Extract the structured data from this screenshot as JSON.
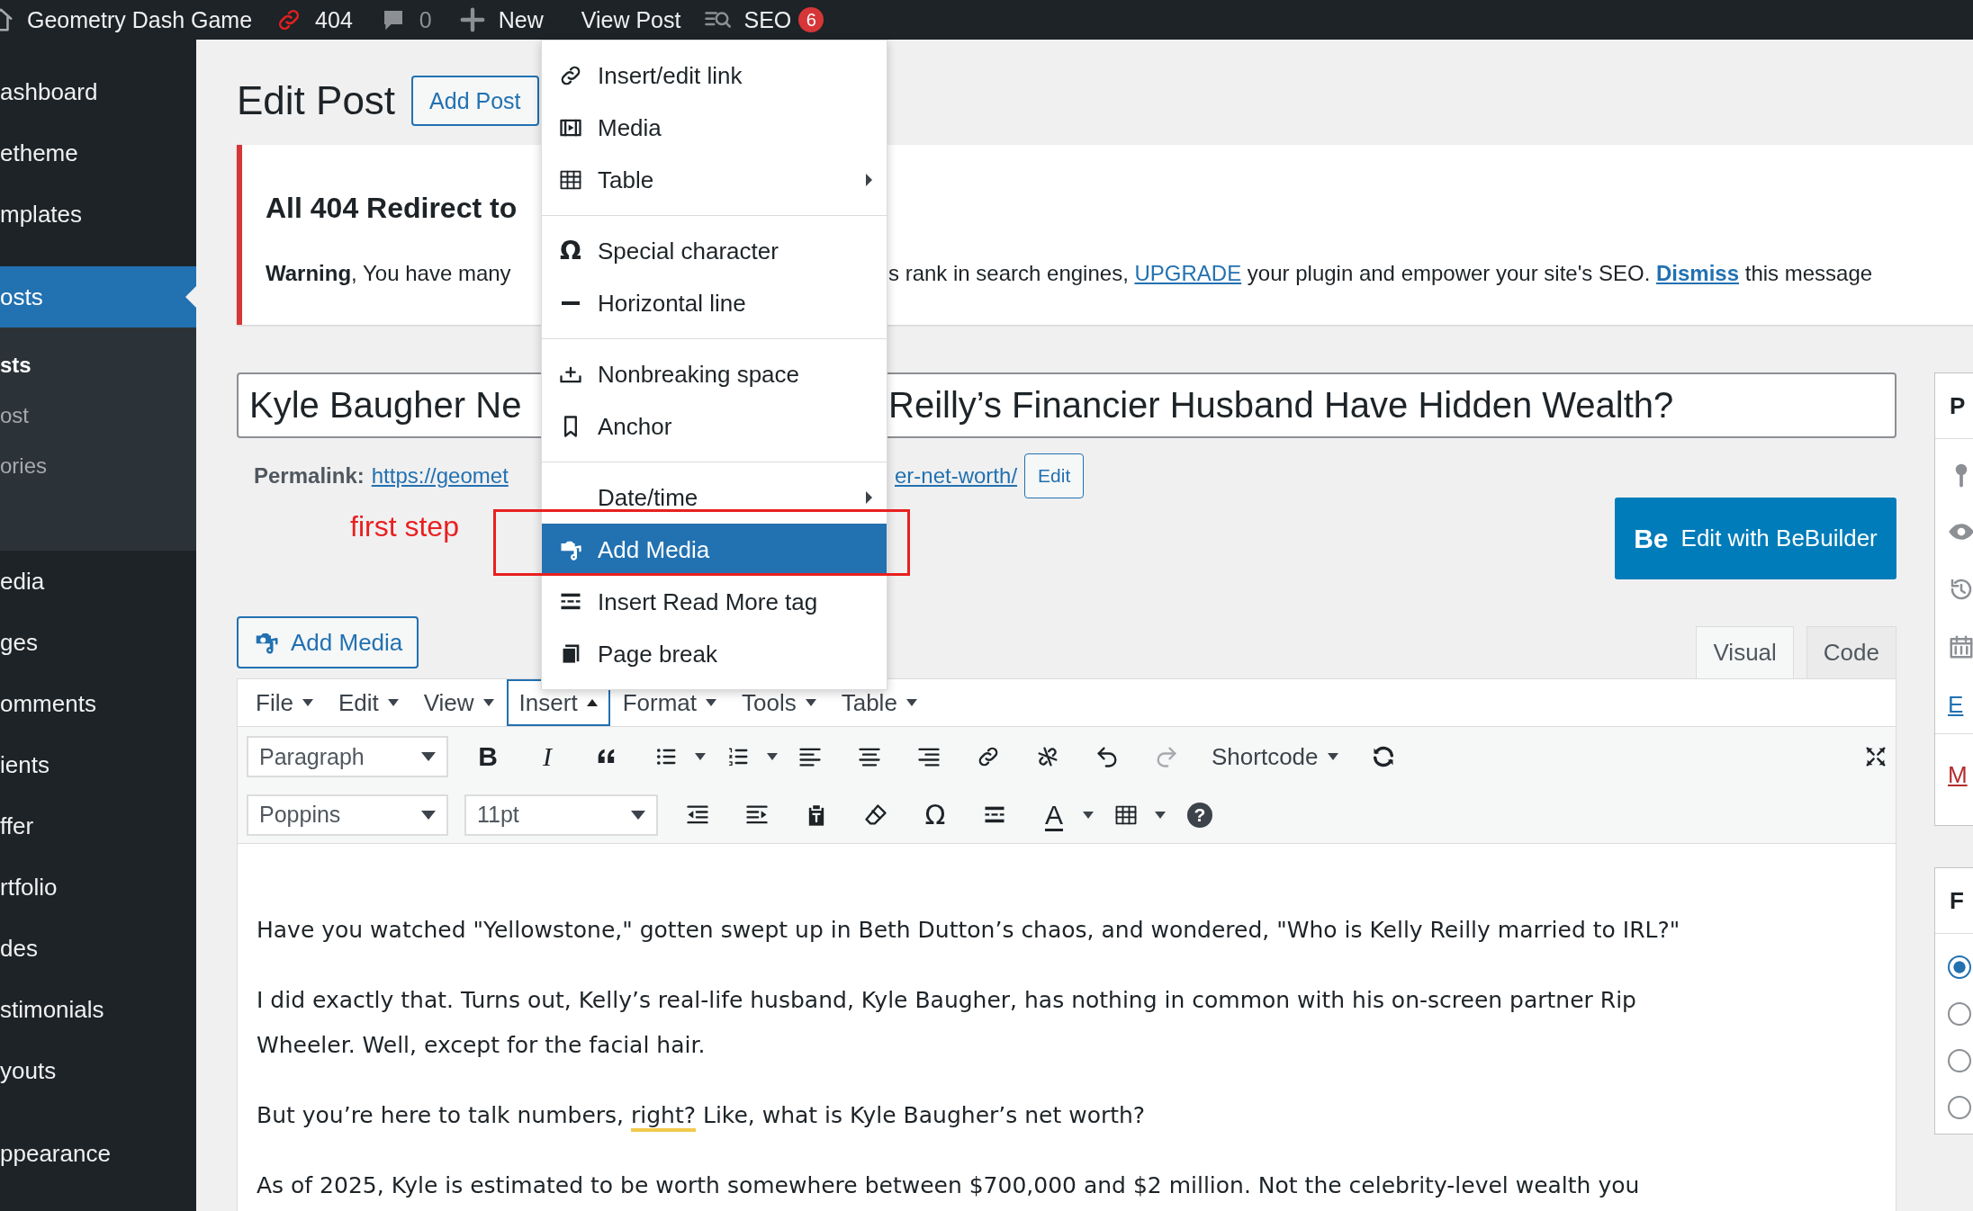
{
  "admin_bar": {
    "site_name": "Geometry Dash Game",
    "redirects_count": "404",
    "comments_count": "0",
    "new_label": "New",
    "view_post_label": "View Post",
    "seo_label": "SEO",
    "seo_badge": "6"
  },
  "sidebar": {
    "groups": [
      {
        "items": [
          {
            "label": "ashboard",
            "selected": false
          },
          {
            "label": "etheme",
            "selected": false
          },
          {
            "label": "mplates",
            "selected": false
          }
        ]
      },
      {
        "items": [
          {
            "label": "osts",
            "selected": true,
            "children": [
              {
                "label": "sts",
                "selected": true
              },
              {
                "label": "ost",
                "selected": false
              },
              {
                "label": "ories",
                "selected": false
              }
            ]
          },
          {
            "label": "edia",
            "selected": false
          },
          {
            "label": "ges",
            "selected": false
          },
          {
            "label": "omments",
            "selected": false
          },
          {
            "label": "ients",
            "selected": false
          },
          {
            "label": "ffer",
            "selected": false
          },
          {
            "label": "rtfolio",
            "selected": false
          },
          {
            "label": "des",
            "selected": false
          },
          {
            "label": "stimonials",
            "selected": false
          },
          {
            "label": "youts",
            "selected": false
          }
        ]
      },
      {
        "items": [
          {
            "label": "ppearance",
            "selected": false
          }
        ]
      }
    ]
  },
  "page": {
    "title": "Edit Post",
    "add_button": "Add Post"
  },
  "notice": {
    "title": "All 404 Redirect to",
    "text_left": "**Warning**, You have many",
    "text_right": [
      {
        "kind": "text",
        "text": "s rank in search engines, "
      },
      {
        "kind": "link",
        "text": "UPGRADE"
      },
      {
        "kind": "text",
        "text": " your plugin and empower your site's SEO.  "
      },
      {
        "kind": "strong_link",
        "text": "Dismiss"
      },
      {
        "kind": "text",
        "text": " this message"
      }
    ]
  },
  "title_field": {
    "value_left": "Kyle Baugher Ne",
    "value_right": "Reilly’s Financier Husband Have Hidden Wealth?"
  },
  "permalink": {
    "label": "Permalink:",
    "url_left": "https://geomet",
    "url_right": "er-net-worth/",
    "edit_button": "Edit"
  },
  "annotation": {
    "text": "first step"
  },
  "bebuilder_button": {
    "logo": "Be",
    "label": "Edit with BeBuilder"
  },
  "insert_menu": {
    "groups": [
      {
        "items": [
          {
            "label": "Insert/edit link",
            "submenu": false,
            "selected": false
          },
          {
            "label": "Media",
            "submenu": false,
            "selected": false
          },
          {
            "label": "Table",
            "submenu": true,
            "selected": false
          }
        ]
      },
      {
        "items": [
          {
            "label": "Special character",
            "glyph": "Ω",
            "submenu": false,
            "selected": false
          },
          {
            "label": "Horizontal line",
            "submenu": false,
            "selected": false
          }
        ]
      },
      {
        "items": [
          {
            "label": "Nonbreaking space",
            "submenu": false,
            "selected": false
          },
          {
            "label": "Anchor",
            "submenu": false,
            "selected": false
          }
        ]
      },
      {
        "items": [
          {
            "label": "Date/time",
            "submenu": true,
            "selected": false
          },
          {
            "label": "Add Media",
            "submenu": false,
            "selected": true
          },
          {
            "label": "Insert Read More tag",
            "submenu": false,
            "selected": false
          },
          {
            "label": "Page break",
            "submenu": false,
            "selected": false
          }
        ]
      }
    ]
  },
  "editor": {
    "add_media_button": "Add Media",
    "tabs": [
      {
        "label": "Visual",
        "selected": true
      },
      {
        "label": "Code",
        "selected": false
      }
    ],
    "menubar": [
      {
        "label": "File",
        "selected": false
      },
      {
        "label": "Edit",
        "selected": false
      },
      {
        "label": "View",
        "selected": false
      },
      {
        "label": "Insert",
        "selected": true
      },
      {
        "label": "Format",
        "selected": false
      },
      {
        "label": "Tools",
        "selected": false
      },
      {
        "label": "Table",
        "selected": false
      }
    ],
    "toolbar": {
      "format_select": "Paragraph",
      "bold": "B",
      "italic": "I",
      "shortcode_dropdown": "Shortcode",
      "redo_disabled": true,
      "font_select": "Poppins",
      "size_select": "11pt",
      "special_char": "Ω",
      "text_color": "A",
      "help": "?"
    },
    "paragraphs": [
      {
        "segments": [
          {
            "text": "Have you watched \"Yellowstone,\" gotten swept up in Beth Dutton’s chaos, and wondered, \"Who is Kelly Reilly married to IRL?\"",
            "flagged": false
          }
        ]
      },
      {
        "segments": [
          {
            "text": "I did exactly that. Turns out, Kelly’s real-life husband, Kyle Baugher, has nothing in common with his on-screen partner Rip Wheeler. Well, except for the facial hair.",
            "flagged": false
          }
        ]
      },
      {
        "segments": [
          {
            "text": "But you’re here to talk numbers, ",
            "flagged": false
          },
          {
            "text": "right?",
            "flagged": true
          },
          {
            "text": " Like, what is Kyle Baugher’s net worth?",
            "flagged": false
          }
        ]
      },
      {
        "segments": [
          {
            "text": "As of 2025, Kyle is estimated to be worth somewhere between $700,000 and $2 million. Not the celebrity-level wealth you",
            "flagged": false
          }
        ]
      }
    ]
  },
  "side_panels": {
    "panel_title": "P",
    "edit_link": "E",
    "red_link": "M",
    "format_title": "F",
    "radios": [
      {
        "selected": true
      },
      {
        "selected": false
      },
      {
        "selected": false
      },
      {
        "selected": false
      }
    ]
  }
}
